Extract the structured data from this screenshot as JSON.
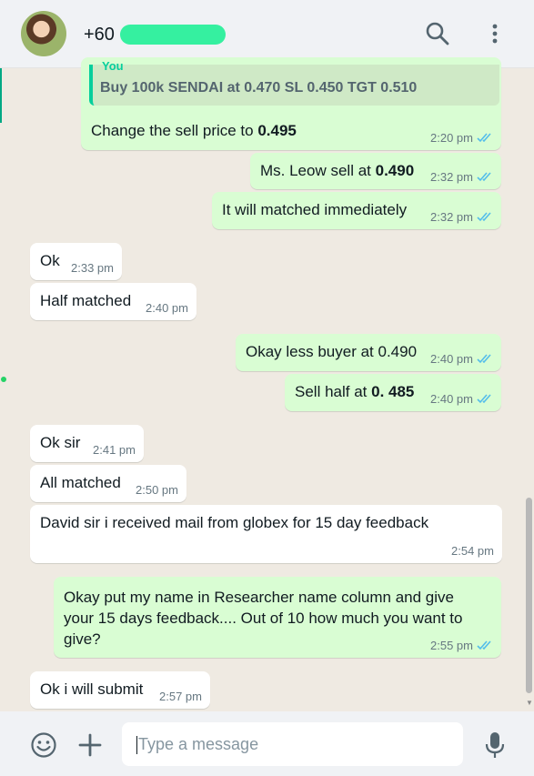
{
  "header": {
    "contact_name": "+60 ",
    "search_icon": "search-icon",
    "menu_icon": "more-vertical-icon"
  },
  "quote": {
    "author": "You",
    "text": "Buy 100k SENDAI at 0.470 SL 0.450 TGT 0.510"
  },
  "messages": [
    {
      "dir": "out",
      "text": "Change the sell price to ",
      "bold": "0.495",
      "time": "2:20 pm"
    },
    {
      "dir": "out",
      "text": "Ms. Leow sell at ",
      "bold": "0.490",
      "time": "2:32 pm"
    },
    {
      "dir": "out",
      "text": "It will matched immediately",
      "bold": "",
      "time": "2:32 pm"
    },
    {
      "dir": "in",
      "text": "Ok",
      "bold": "",
      "time": "2:33 pm"
    },
    {
      "dir": "in",
      "text": "Half matched",
      "bold": "",
      "time": "2:40 pm"
    },
    {
      "dir": "out",
      "text": "Okay less buyer at 0.490",
      "bold": "",
      "time": "2:40 pm"
    },
    {
      "dir": "out",
      "text": "Sell half at ",
      "bold": "0. 485",
      "time": "2:40 pm"
    },
    {
      "dir": "in",
      "text": "Ok sir",
      "bold": "",
      "time": "2:41 pm"
    },
    {
      "dir": "in",
      "text": "All matched",
      "bold": "",
      "time": "2:50 pm"
    },
    {
      "dir": "in",
      "text": "David sir i received mail from globex for 15 day feedback",
      "bold": "",
      "time": "2:54 pm"
    },
    {
      "dir": "out",
      "lines": [
        "Okay put my name in Researcher name column and give",
        "your 15 days feedback.... Out of 10 how much you want to",
        "give?"
      ],
      "time": "2:55 pm"
    },
    {
      "dir": "in",
      "text": "Ok i will submit",
      "bold": "",
      "time": "2:57 pm"
    }
  ],
  "composer": {
    "placeholder": "Type a message",
    "emoji_icon": "emoji-icon",
    "attach_icon": "plus-icon",
    "mic_icon": "microphone-icon"
  },
  "colors": {
    "outgoing_bubble": "#d9fdd3",
    "incoming_bubble": "#ffffff",
    "read_ticks": "#53bdeb",
    "accent": "#00a884"
  }
}
